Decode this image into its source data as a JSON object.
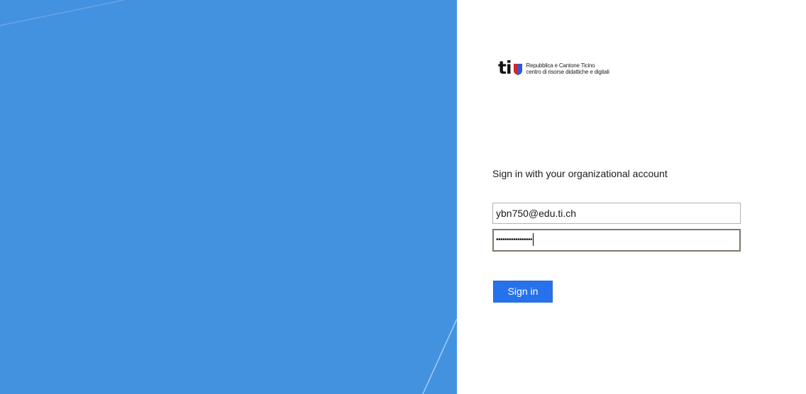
{
  "logo": {
    "mark": "ti",
    "line1": "Repubblica e Cantone Ticino",
    "line2": "centro di risorse didattiche e digitali"
  },
  "form": {
    "heading": "Sign in with your organizational account",
    "email_value": "ybn750@edu.ti.ch",
    "password_masked": "•••••••••••••••••",
    "signin_label": "Sign in"
  },
  "colors": {
    "illustration_bg": "#4392e0",
    "button_bg": "#2672ec",
    "focus_border": "#7f766c"
  }
}
